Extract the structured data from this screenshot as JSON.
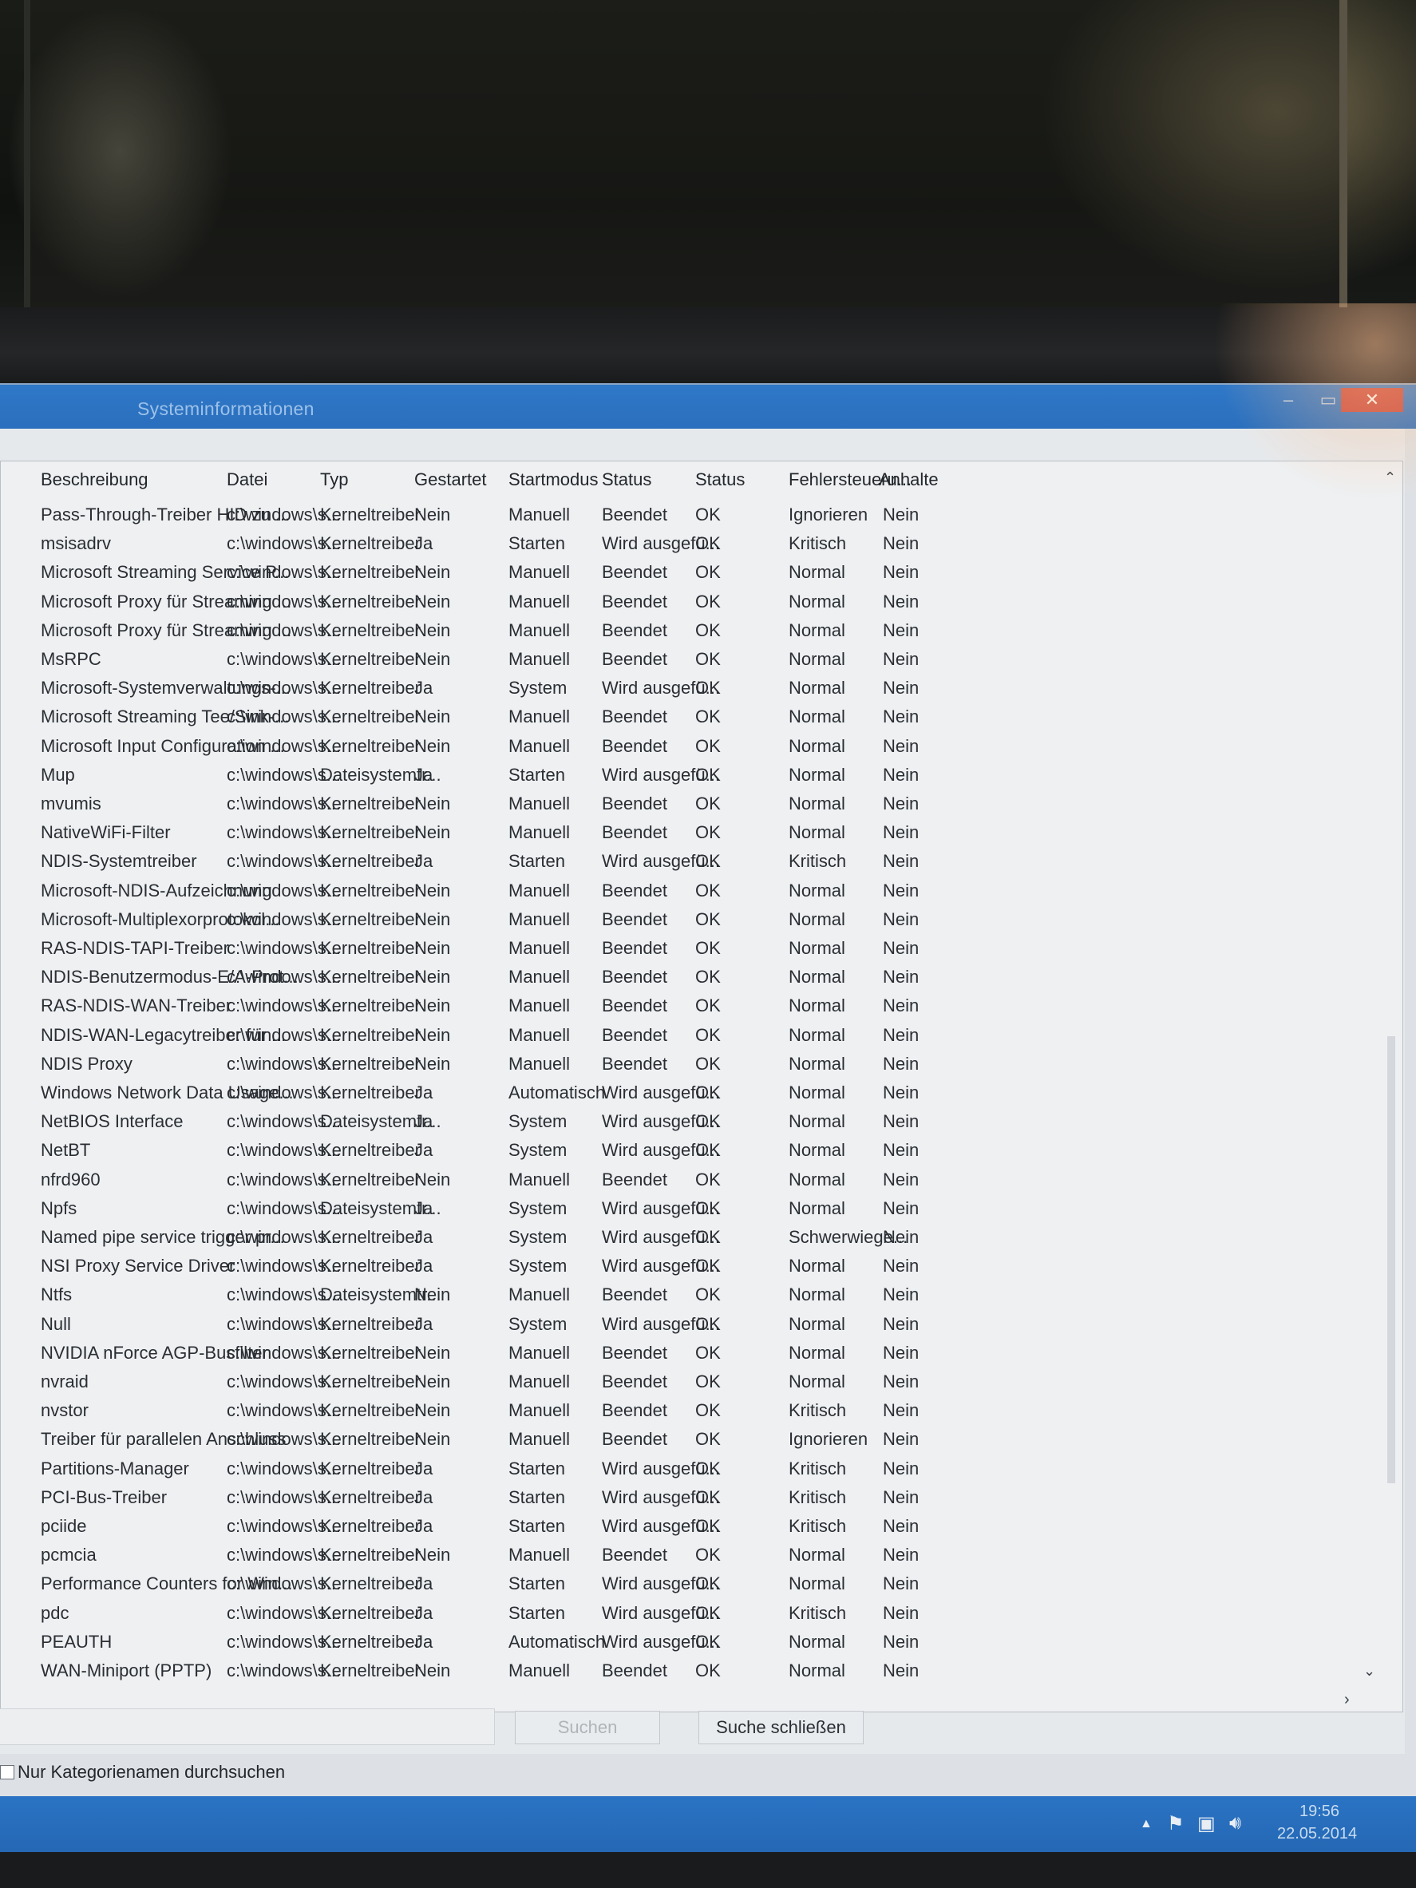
{
  "window": {
    "title": "Systeminformationen",
    "close_glyph": "✕",
    "maximize_glyph": "▭",
    "minimize_glyph": "–"
  },
  "table": {
    "headers": [
      "Beschreibung",
      "Datei",
      "Typ",
      "Gestartet",
      "Startmodus",
      "Status",
      "Status",
      "Fehlersteueru...",
      "Anhalte"
    ],
    "rows": [
      [
        "Pass-Through-Treiber HID zu ...",
        "c:\\windows\\s...",
        "Kerneltreiber",
        "Nein",
        "Manuell",
        "Beendet",
        "OK",
        "Ignorieren",
        "Nein"
      ],
      [
        "msisadrv",
        "c:\\windows\\s...",
        "Kerneltreiber",
        "Ja",
        "Starten",
        "Wird ausgefü...",
        "OK",
        "Kritisch",
        "Nein"
      ],
      [
        "Microsoft Streaming Service P...",
        "c:\\windows\\s...",
        "Kerneltreiber",
        "Nein",
        "Manuell",
        "Beendet",
        "OK",
        "Normal",
        "Nein"
      ],
      [
        "Microsoft Proxy für Streaming ...",
        "c:\\windows\\s...",
        "Kerneltreiber",
        "Nein",
        "Manuell",
        "Beendet",
        "OK",
        "Normal",
        "Nein"
      ],
      [
        "Microsoft Proxy für Streaming ...",
        "c:\\windows\\s...",
        "Kerneltreiber",
        "Nein",
        "Manuell",
        "Beendet",
        "OK",
        "Normal",
        "Nein"
      ],
      [
        "MsRPC",
        "c:\\windows\\s...",
        "Kerneltreiber",
        "Nein",
        "Manuell",
        "Beendet",
        "OK",
        "Normal",
        "Nein"
      ],
      [
        "Microsoft-Systemverwaltungs-...",
        "c:\\windows\\s...",
        "Kerneltreiber",
        "Ja",
        "System",
        "Wird ausgefü...",
        "OK",
        "Normal",
        "Nein"
      ],
      [
        "Microsoft Streaming Tee/Sink-...",
        "c:\\windows\\s...",
        "Kerneltreiber",
        "Nein",
        "Manuell",
        "Beendet",
        "OK",
        "Normal",
        "Nein"
      ],
      [
        "Microsoft Input Configuration ...",
        "c:\\windows\\s...",
        "Kerneltreiber",
        "Nein",
        "Manuell",
        "Beendet",
        "OK",
        "Normal",
        "Nein"
      ],
      [
        "Mup",
        "c:\\windows\\s...",
        "Dateisystemtr...",
        "Ja",
        "Starten",
        "Wird ausgefü...",
        "OK",
        "Normal",
        "Nein"
      ],
      [
        "mvumis",
        "c:\\windows\\s...",
        "Kerneltreiber",
        "Nein",
        "Manuell",
        "Beendet",
        "OK",
        "Normal",
        "Nein"
      ],
      [
        "NativeWiFi-Filter",
        "c:\\windows\\s...",
        "Kerneltreiber",
        "Nein",
        "Manuell",
        "Beendet",
        "OK",
        "Normal",
        "Nein"
      ],
      [
        "NDIS-Systemtreiber",
        "c:\\windows\\s...",
        "Kerneltreiber",
        "Ja",
        "Starten",
        "Wird ausgefü...",
        "OK",
        "Kritisch",
        "Nein"
      ],
      [
        "Microsoft-NDIS-Aufzeichnung",
        "c:\\windows\\s...",
        "Kerneltreiber",
        "Nein",
        "Manuell",
        "Beendet",
        "OK",
        "Normal",
        "Nein"
      ],
      [
        "Microsoft-Multiplexorprotokol...",
        "c:\\windows\\s...",
        "Kerneltreiber",
        "Nein",
        "Manuell",
        "Beendet",
        "OK",
        "Normal",
        "Nein"
      ],
      [
        "RAS-NDIS-TAPI-Treiber",
        "c:\\windows\\s...",
        "Kerneltreiber",
        "Nein",
        "Manuell",
        "Beendet",
        "OK",
        "Normal",
        "Nein"
      ],
      [
        "NDIS-Benutzermodus-E/A-Prot...",
        "c:\\windows\\s...",
        "Kerneltreiber",
        "Nein",
        "Manuell",
        "Beendet",
        "OK",
        "Normal",
        "Nein"
      ],
      [
        "RAS-NDIS-WAN-Treiber",
        "c:\\windows\\s...",
        "Kerneltreiber",
        "Nein",
        "Manuell",
        "Beendet",
        "OK",
        "Normal",
        "Nein"
      ],
      [
        "NDIS-WAN-Legacytreiber für ...",
        "c:\\windows\\s...",
        "Kerneltreiber",
        "Nein",
        "Manuell",
        "Beendet",
        "OK",
        "Normal",
        "Nein"
      ],
      [
        "NDIS Proxy",
        "c:\\windows\\s...",
        "Kerneltreiber",
        "Nein",
        "Manuell",
        "Beendet",
        "OK",
        "Normal",
        "Nein"
      ],
      [
        "Windows Network Data Usage...",
        "c:\\windows\\s...",
        "Kerneltreiber",
        "Ja",
        "Automatisch",
        "Wird ausgefü...",
        "OK",
        "Normal",
        "Nein"
      ],
      [
        "NetBIOS Interface",
        "c:\\windows\\s...",
        "Dateisystemtr...",
        "Ja",
        "System",
        "Wird ausgefü...",
        "OK",
        "Normal",
        "Nein"
      ],
      [
        "NetBT",
        "c:\\windows\\s...",
        "Kerneltreiber",
        "Ja",
        "System",
        "Wird ausgefü...",
        "OK",
        "Normal",
        "Nein"
      ],
      [
        "nfrd960",
        "c:\\windows\\s...",
        "Kerneltreiber",
        "Nein",
        "Manuell",
        "Beendet",
        "OK",
        "Normal",
        "Nein"
      ],
      [
        "Npfs",
        "c:\\windows\\s...",
        "Dateisystemtr...",
        "Ja",
        "System",
        "Wird ausgefü...",
        "OK",
        "Normal",
        "Nein"
      ],
      [
        "Named pipe service trigger pr...",
        "c:\\windows\\s...",
        "Kerneltreiber",
        "Ja",
        "System",
        "Wird ausgefü...",
        "OK",
        "Schwerwiege...",
        "Nein"
      ],
      [
        "NSI Proxy Service Driver",
        "c:\\windows\\s...",
        "Kerneltreiber",
        "Ja",
        "System",
        "Wird ausgefü...",
        "OK",
        "Normal",
        "Nein"
      ],
      [
        "Ntfs",
        "c:\\windows\\s...",
        "Dateisystemtr...",
        "Nein",
        "Manuell",
        "Beendet",
        "OK",
        "Normal",
        "Nein"
      ],
      [
        "Null",
        "c:\\windows\\s...",
        "Kerneltreiber",
        "Ja",
        "System",
        "Wird ausgefü...",
        "OK",
        "Normal",
        "Nein"
      ],
      [
        "NVIDIA nForce AGP-Busfilter",
        "c:\\windows\\s...",
        "Kerneltreiber",
        "Nein",
        "Manuell",
        "Beendet",
        "OK",
        "Normal",
        "Nein"
      ],
      [
        "nvraid",
        "c:\\windows\\s...",
        "Kerneltreiber",
        "Nein",
        "Manuell",
        "Beendet",
        "OK",
        "Normal",
        "Nein"
      ],
      [
        "nvstor",
        "c:\\windows\\s...",
        "Kerneltreiber",
        "Nein",
        "Manuell",
        "Beendet",
        "OK",
        "Kritisch",
        "Nein"
      ],
      [
        "Treiber für parallelen Anschluss",
        "c:\\windows\\s...",
        "Kerneltreiber",
        "Nein",
        "Manuell",
        "Beendet",
        "OK",
        "Ignorieren",
        "Nein"
      ],
      [
        "Partitions-Manager",
        "c:\\windows\\s...",
        "Kerneltreiber",
        "Ja",
        "Starten",
        "Wird ausgefü...",
        "OK",
        "Kritisch",
        "Nein"
      ],
      [
        "PCI-Bus-Treiber",
        "c:\\windows\\s...",
        "Kerneltreiber",
        "Ja",
        "Starten",
        "Wird ausgefü...",
        "OK",
        "Kritisch",
        "Nein"
      ],
      [
        "pciide",
        "c:\\windows\\s...",
        "Kerneltreiber",
        "Ja",
        "Starten",
        "Wird ausgefü...",
        "OK",
        "Kritisch",
        "Nein"
      ],
      [
        "pcmcia",
        "c:\\windows\\s...",
        "Kerneltreiber",
        "Nein",
        "Manuell",
        "Beendet",
        "OK",
        "Normal",
        "Nein"
      ],
      [
        "Performance Counters for Win...",
        "c:\\windows\\s...",
        "Kerneltreiber",
        "Ja",
        "Starten",
        "Wird ausgefü...",
        "OK",
        "Normal",
        "Nein"
      ],
      [
        "pdc",
        "c:\\windows\\s...",
        "Kerneltreiber",
        "Ja",
        "Starten",
        "Wird ausgefü...",
        "OK",
        "Kritisch",
        "Nein"
      ],
      [
        "PEAUTH",
        "c:\\windows\\s...",
        "Kerneltreiber",
        "Ja",
        "Automatisch",
        "Wird ausgefü...",
        "OK",
        "Normal",
        "Nein"
      ],
      [
        "WAN-Miniport (PPTP)",
        "c:\\windows\\s...",
        "Kerneltreiber",
        "Nein",
        "Manuell",
        "Beendet",
        "OK",
        "Normal",
        "Nein"
      ]
    ]
  },
  "search": {
    "input_value": "",
    "search_button": "Suchen",
    "close_search_button": "Suche schließen",
    "category_checkbox_label": "Nur Kategorienamen durchsuchen",
    "category_checkbox_checked": false
  },
  "taskbar": {
    "time": "19:56",
    "date": "22.05.2014",
    "tray_icons": [
      "show-hidden-icons-chevron",
      "action-center-flag",
      "network-icon",
      "volume-icon"
    ]
  },
  "colors": {
    "titlebar": "#2f78c8",
    "taskbar": "#2a73c4",
    "close_button": "#c9463b"
  }
}
